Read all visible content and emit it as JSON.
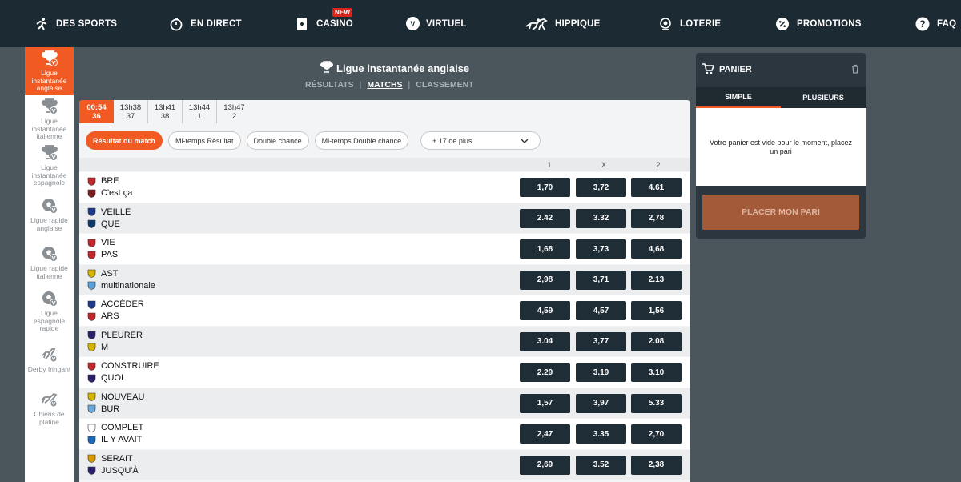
{
  "nav": {
    "sports": "DES SPORTS",
    "live": "EN DIRECT",
    "casino": "CASINO",
    "casino_badge": "NEW",
    "virtual": "VIRTUEL",
    "virtual_letter": "V",
    "hippique": "HIPPIQUE",
    "lottery": "LOTERIE",
    "promotions": "PROMOTIONS",
    "faq": "FAQ"
  },
  "sidebar": {
    "items": [
      {
        "label": "Ligue instantanée anglaise",
        "icon": "trophy-icon"
      },
      {
        "label": "Ligue instantanée italienne",
        "icon": "trophy-icon"
      },
      {
        "label": "Ligue instantanée espagnole",
        "icon": "trophy-icon"
      },
      {
        "label": "Ligue rapide anglaise",
        "icon": "soccer-ball-icon"
      },
      {
        "label": "Ligue rapide italienne",
        "icon": "soccer-ball-icon"
      },
      {
        "label": "Ligue espagnole rapide",
        "icon": "soccer-ball-icon"
      },
      {
        "label": "Derby fringant",
        "icon": "horse-icon"
      },
      {
        "label": "Chiens de platine",
        "icon": "dog-icon"
      }
    ]
  },
  "header": {
    "title": "Ligue instantanée anglaise",
    "subnav": [
      "RÉSULTATS",
      "MATCHS",
      "CLASSEMENT"
    ]
  },
  "time_tabs": [
    {
      "time": "00:54",
      "num": "36"
    },
    {
      "time": "13h38",
      "num": "37"
    },
    {
      "time": "13h41",
      "num": "38"
    },
    {
      "time": "13h44",
      "num": "1"
    },
    {
      "time": "13h47",
      "num": "2"
    }
  ],
  "filters": [
    "Résultat du match",
    "Mi-temps Résultat",
    "Double chance",
    "Mi-temps Double chance",
    "+ 17 de plus"
  ],
  "columns": [
    "1",
    "X",
    "2"
  ],
  "matches": [
    {
      "home": "BRE",
      "away": "C'est ça",
      "o1": "1,70",
      "ox": "3,72",
      "o2": "4.61"
    },
    {
      "home": "VEILLE",
      "away": "QUE",
      "o1": "2.42",
      "ox": "3.32",
      "o2": "2,78"
    },
    {
      "home": "VIE",
      "away": "PAS",
      "o1": "1,68",
      "ox": "3,73",
      "o2": "4,68"
    },
    {
      "home": "AST",
      "away": "multinationale",
      "o1": "2,98",
      "ox": "3,71",
      "o2": "2.13"
    },
    {
      "home": "ACCÉDER",
      "away": "ARS",
      "o1": "4,59",
      "ox": "4,57",
      "o2": "1,56"
    },
    {
      "home": "PLEURER",
      "away": "M",
      "o1": "3.04",
      "ox": "3,77",
      "o2": "2.08"
    },
    {
      "home": "CONSTRUIRE",
      "away": "QUOI",
      "o1": "2.29",
      "ox": "3.19",
      "o2": "3.10"
    },
    {
      "home": "NOUVEAU",
      "away": "BUR",
      "o1": "1,57",
      "ox": "3,97",
      "o2": "5.33"
    },
    {
      "home": "COMPLET",
      "away": "IL Y AVAIT",
      "o1": "2,47",
      "ox": "3.35",
      "o2": "2,70"
    },
    {
      "home": "SERAIT",
      "away": "JUSQU'À",
      "o1": "2,69",
      "ox": "3.52",
      "o2": "2,38"
    }
  ],
  "cart": {
    "title": "PANIER",
    "tab_single": "SIMPLE",
    "tab_multi": "PLUSIEURS",
    "empty_text": "Votre panier est vide pour le moment, placez un pari",
    "place_bet": "PLACER MON PARI"
  },
  "colors": {
    "accent": "#f15a22",
    "nav_bg": "#1c2a33",
    "odds_bg": "#1f2d36"
  }
}
